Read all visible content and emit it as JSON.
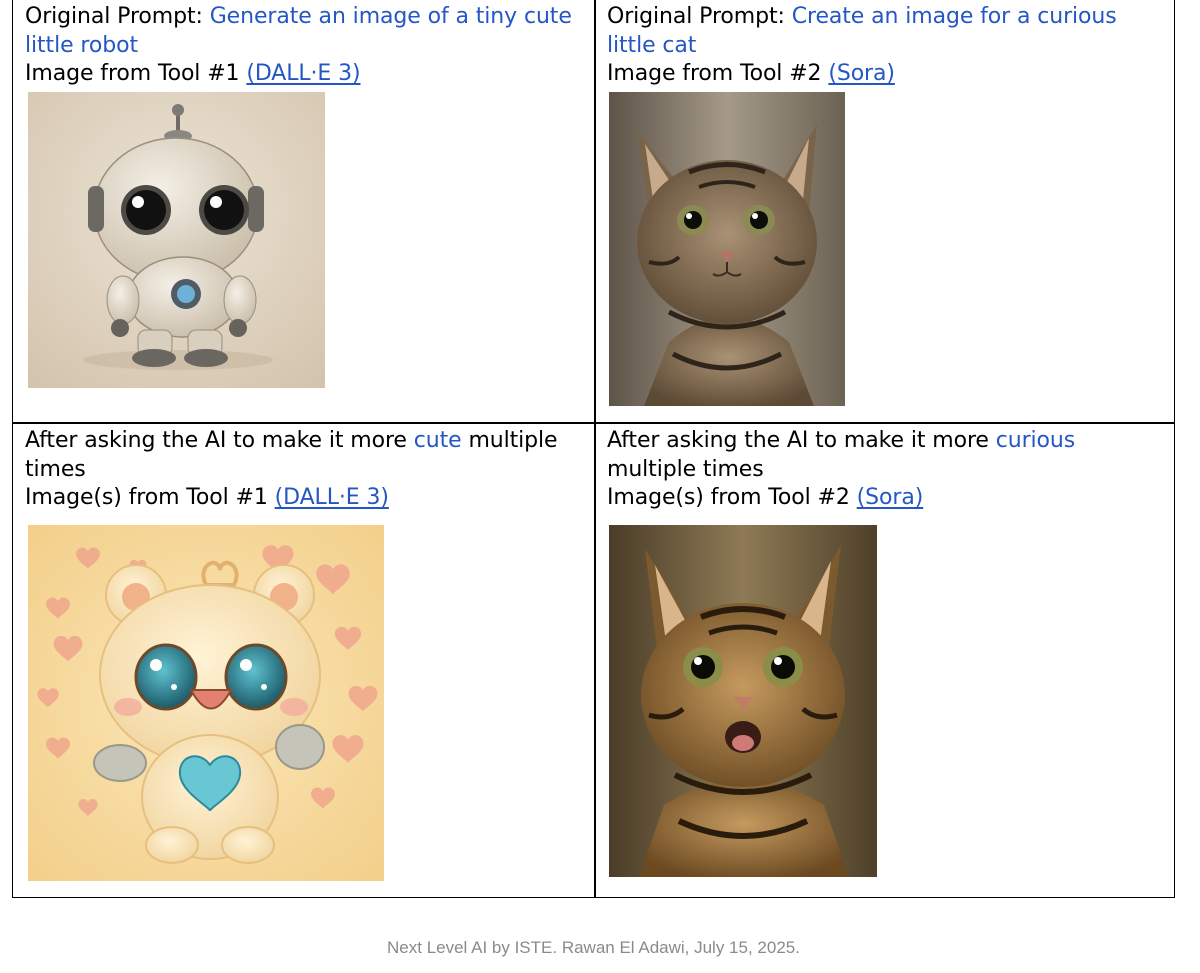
{
  "cells": {
    "top_left": {
      "prompt_label": "Original Prompt: ",
      "prompt_text": "Generate an image of a tiny cute little robot",
      "tool_label": "Image from Tool #1 ",
      "tool_link": "(DALL·E 3)"
    },
    "top_right": {
      "prompt_label": "Original Prompt: ",
      "prompt_text": "Create an image for a curious little cat",
      "tool_label": "Image from Tool #2 ",
      "tool_link": "(Sora)"
    },
    "bottom_left": {
      "pre": "After asking the AI to make it more ",
      "keyword": "cute",
      "post": " multiple times",
      "tool_label": "Image(s) from Tool #1 ",
      "tool_link": "(DALL·E 3)"
    },
    "bottom_right": {
      "pre": "After asking the AI to make it more ",
      "keyword": "curious",
      "post": " multiple times",
      "tool_label": "Image(s) from Tool #2 ",
      "tool_link": "(Sora)"
    }
  },
  "images": {
    "robot": "cute robot illustration",
    "cat": "tabby kitten photo",
    "bear": "cute bear illustration with hearts",
    "cat_surprised": "surprised tabby kitten photo"
  },
  "colors": {
    "link_blue": "#2457c5",
    "footer_gray": "#8a8a8a"
  },
  "footer": "Next Level AI by ISTE. Rawan El Adawi, July 15, 2025."
}
